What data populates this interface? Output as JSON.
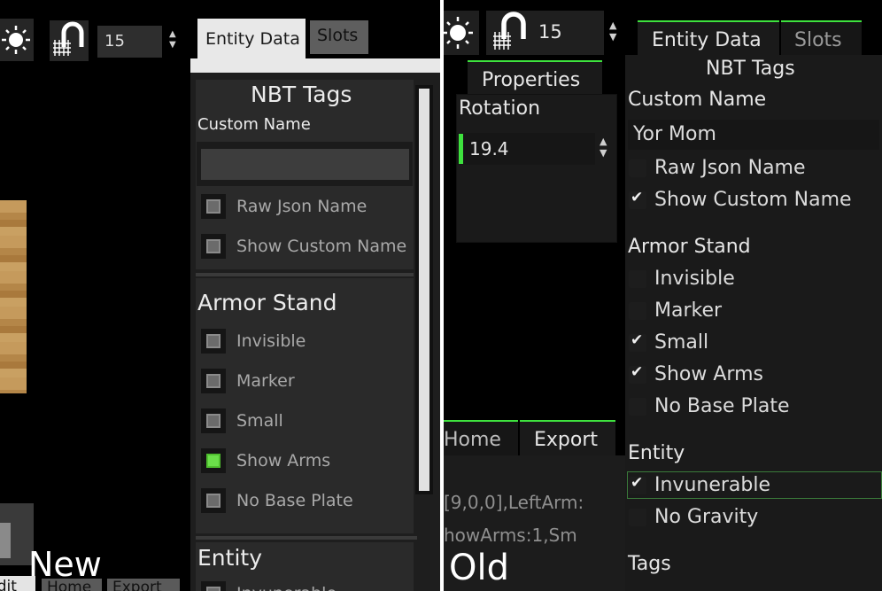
{
  "new_ui": {
    "caption": "New",
    "toolbar": {
      "sun_icon": "sun-icon",
      "magnet_icon": "magnet-grid-icon",
      "snap_value": "15"
    },
    "tabs": {
      "entity_data": "Entity Data",
      "slots": "Slots"
    },
    "panel": {
      "title": "NBT Tags",
      "custom_name_label": "Custom Name",
      "custom_name_value": "",
      "raw_json_label": "Raw Json Name",
      "show_custom_name_label": "Show Custom Name",
      "armor_stand_heading": "Armor Stand",
      "invisible_label": "Invisible",
      "marker_label": "Marker",
      "small_label": "Small",
      "show_arms_label": "Show Arms",
      "no_base_plate_label": "No Base Plate",
      "entity_heading": "Entity",
      "invulnerable_label": "Invunerable"
    },
    "checked": {
      "raw_json": false,
      "show_custom_name": false,
      "invisible": false,
      "marker": false,
      "small": false,
      "show_arms": true,
      "no_base_plate": false
    },
    "bottom_tabs": {
      "edit": "Edit",
      "home": "Home",
      "export": "Export"
    }
  },
  "old_ui": {
    "caption": "Old",
    "toolbar": {
      "sun_icon": "sun-icon",
      "magnet_icon": "magnet-grid-icon",
      "snap_value": "15"
    },
    "properties": {
      "tab": "Properties",
      "rotation_label": "Rotation",
      "rotation_value": "19.4"
    },
    "bottom_tabs": {
      "home": "Home",
      "export": "Export"
    },
    "export_lines": [
      "[9,0,0],LeftArm:",
      "howArms:1,Sm"
    ],
    "tabs": {
      "entity_data": "Entity Data",
      "slots": "Slots"
    },
    "panel": {
      "title": "NBT Tags",
      "custom_name_label": "Custom Name",
      "custom_name_value": "Yor Mom",
      "raw_json_label": "Raw Json Name",
      "show_custom_name_label": "Show Custom Name",
      "armor_stand_heading": "Armor Stand",
      "invisible_label": "Invisible",
      "marker_label": "Marker",
      "small_label": "Small",
      "show_arms_label": "Show Arms",
      "no_base_plate_label": "No Base Plate",
      "entity_heading": "Entity",
      "invulnerable_label": "Invunerable",
      "no_gravity_label": "No Gravity",
      "tags_heading": "Tags"
    },
    "checked": {
      "raw_json": false,
      "show_custom_name": true,
      "invisible": false,
      "marker": false,
      "small": true,
      "show_arms": true,
      "no_base_plate": false,
      "invulnerable": true,
      "no_gravity": false
    }
  },
  "colors": {
    "accent_green": "#3ee23e",
    "divider": "#ffffff"
  }
}
